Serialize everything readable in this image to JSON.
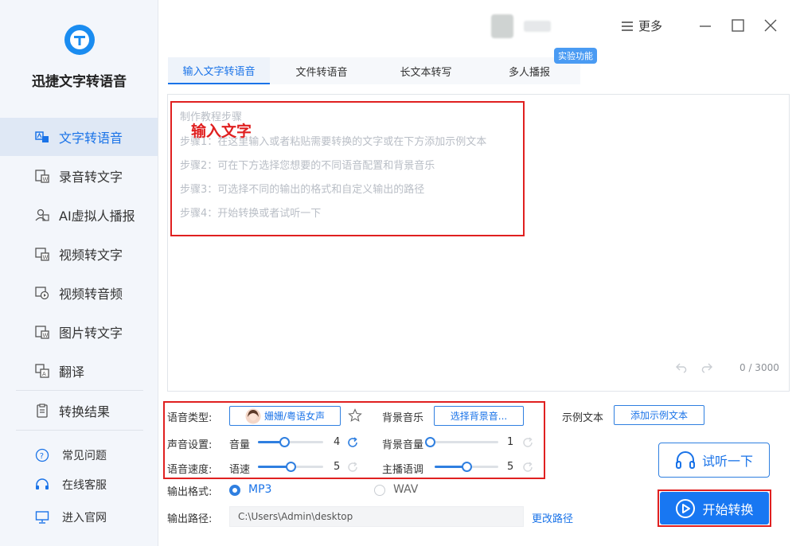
{
  "app": {
    "name": "迅捷文字转语音"
  },
  "sidebar": {
    "items": [
      {
        "label": "文字转语音",
        "icon": "text-to-speech-icon",
        "active": true
      },
      {
        "label": "录音转文字",
        "icon": "recording-to-text-icon"
      },
      {
        "label": "AI虚拟人播报",
        "icon": "ai-avatar-icon"
      },
      {
        "label": "视频转文字",
        "icon": "video-to-text-icon"
      },
      {
        "label": "视频转音频",
        "icon": "video-to-audio-icon"
      },
      {
        "label": "图片转文字",
        "icon": "image-to-text-icon"
      },
      {
        "label": "翻译",
        "icon": "translate-icon"
      },
      {
        "label": "转换结果",
        "icon": "results-icon"
      }
    ],
    "help": [
      {
        "label": "常见问题",
        "icon": "question-icon"
      },
      {
        "label": "在线客服",
        "icon": "headset-icon"
      },
      {
        "label": "进入官网",
        "icon": "monitor-icon"
      }
    ]
  },
  "header": {
    "more_label": "更多"
  },
  "tabs": [
    {
      "label": "输入文字转语音",
      "active": true
    },
    {
      "label": "文件转语音"
    },
    {
      "label": "长文本转写"
    },
    {
      "label": "多人播报"
    }
  ],
  "badge": "实验功能",
  "editor": {
    "guide": [
      "制作教程步骤",
      "步骤1：在这里输入或者粘贴需要转换的文字或在下方添加示例文本",
      "步骤2：可在下方选择您想要的不同语音配置和背景音乐",
      "步骤3：可选择不同的输出的格式和自定义输出的路径",
      "步骤4：开始转换或者试听一下"
    ],
    "annotation": "输入文字",
    "counter": "0 / 3000"
  },
  "settings": {
    "voice_type_label": "语音类型:",
    "voice_name": "姗姗/粤语女声",
    "bg_music_label": "背景音乐",
    "bg_music_button": "选择背景音...",
    "sample_text_label": "示例文本",
    "sample_text_button": "添加示例文本",
    "sound_label": "声音设置:",
    "volume_label": "音量",
    "volume_value": "4",
    "volume_level": 0.4,
    "bg_volume_label": "背景音量",
    "bg_volume_value": "1",
    "bg_volume_level": 0.0,
    "speed_section_label": "语音速度:",
    "speed_label": "语速",
    "speed_value": "5",
    "speed_level": 0.5,
    "pitch_label": "主播语调",
    "pitch_value": "5",
    "pitch_level": 0.5,
    "output_format_label": "输出格式:",
    "format_mp3": "MP3",
    "format_wav": "WAV",
    "output_path_label": "输出路径:",
    "output_path": "C:\\Users\\Admin\\desktop",
    "change_path": "更改路径"
  },
  "actions": {
    "listen": "试听一下",
    "start": "开始转换"
  },
  "colors": {
    "accent": "#1877f2",
    "annotation": "#e02020"
  }
}
